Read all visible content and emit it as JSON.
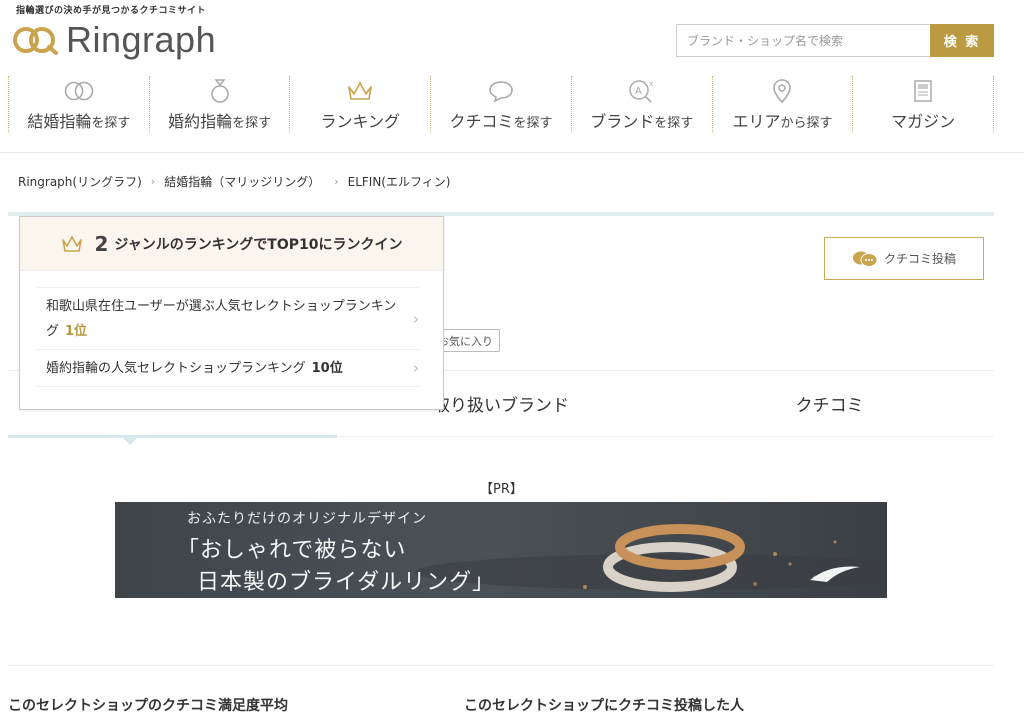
{
  "header": {
    "tagline": "指輪選びの決め手が見つかるクチコミサイト",
    "logo_text": "Ringraph",
    "search": {
      "placeholder": "ブランド・ショップ名で検索",
      "button": "検 索"
    }
  },
  "nav": [
    {
      "main": "結婚指輪",
      "sub": "を探す",
      "icon": "rings-icon"
    },
    {
      "main": "婚約指輪",
      "sub": "を探す",
      "icon": "diamond-ring-icon"
    },
    {
      "main": "ランキング",
      "sub": "",
      "icon": "crown-icon"
    },
    {
      "main": "クチコミ",
      "sub": "を探す",
      "icon": "speech-bubble-icon"
    },
    {
      "main": "ブランド",
      "sub": "を探す",
      "icon": "brand-search-icon"
    },
    {
      "main": "エリア",
      "sub": "から探す",
      "icon": "map-pin-icon"
    },
    {
      "main": "マガジン",
      "sub": "",
      "icon": "magazine-icon"
    }
  ],
  "breadcrumb": [
    "Ringraph(リングラフ)",
    "結婚指輪（マリッジリング）",
    "ELFIN(エルフィン)"
  ],
  "review_post_button": "クチコミ投稿",
  "favorite_button": "お気に入り",
  "ranking_popup": {
    "count": "2",
    "heading": "ジャンルのランキングでTOP10にランクイン",
    "items": [
      {
        "text": "和歌山県在住ユーザーが選ぶ人気セレクトショップランキング",
        "rank": "1位"
      },
      {
        "text": "婚約指輪の人気セレクトショップランキング",
        "rank": "10位"
      }
    ]
  },
  "tabs": [
    "",
    "取り扱いブランド",
    "クチコミ"
  ],
  "pr_label": "【PR】",
  "banner": {
    "line1": "おふたりだけのオリジナルデザイン",
    "line2": "「おしゃれで被らない",
    "line3": "日本製のブライダルリング」"
  },
  "sections": {
    "satisfaction_title": "このセレクトショップのクチコミ満足度平均",
    "reviewers_title": "このセレクトショップにクチコミ投稿した人"
  },
  "colors": {
    "gold": "#bb9a41",
    "teal_light": "#e1eef0"
  }
}
